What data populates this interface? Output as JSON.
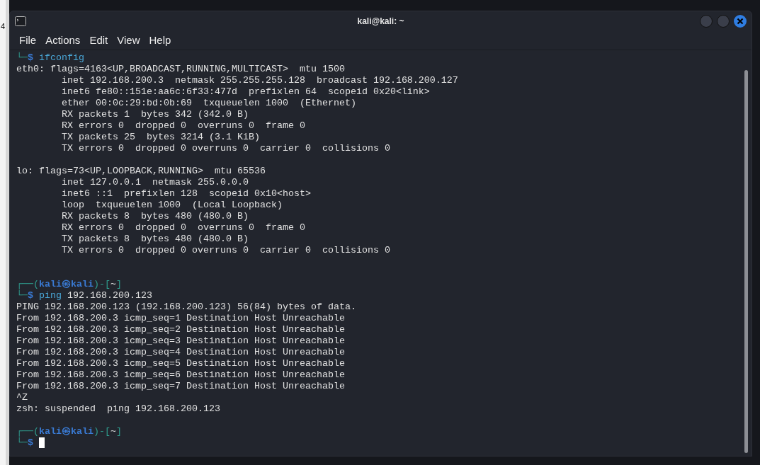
{
  "desktop": {
    "edge_text": "4"
  },
  "window": {
    "title": "kali@kali: ~",
    "controls": [
      {
        "kind": "minimize"
      },
      {
        "kind": "maximize"
      },
      {
        "kind": "close"
      }
    ]
  },
  "menu": [
    "File",
    "Actions",
    "Edit",
    "View",
    "Help"
  ],
  "lines": [
    {
      "kind": "text",
      "segments": [
        {
          "kind": "frame",
          "text": "└─"
        },
        {
          "kind": "dollar",
          "text": "$"
        },
        {
          "kind": "cmd",
          "text": "ifconfig"
        }
      ]
    },
    {
      "kind": "text",
      "segments": [
        {
          "kind": "plain",
          "text": "eth0: flags=4163<UP,BROADCAST,RUNNING,MULTICAST>  mtu 1500"
        }
      ]
    },
    {
      "kind": "text",
      "segments": [
        {
          "kind": "plain",
          "text": "        inet 192.168.200.3  netmask 255.255.255.128  broadcast 192.168.200.127"
        }
      ]
    },
    {
      "kind": "text",
      "segments": [
        {
          "kind": "plain",
          "text": "        inet6 fe80::151e:aa6c:6f33:477d  prefixlen 64  scopeid 0x20<link>"
        }
      ]
    },
    {
      "kind": "text",
      "segments": [
        {
          "kind": "plain",
          "text": "        ether 00:0c:29:bd:0b:69  txqueuelen 1000  (Ethernet)"
        }
      ]
    },
    {
      "kind": "text",
      "segments": [
        {
          "kind": "plain",
          "text": "        RX packets 1  bytes 342 (342.0 B)"
        }
      ]
    },
    {
      "kind": "text",
      "segments": [
        {
          "kind": "plain",
          "text": "        RX errors 0  dropped 0  overruns 0  frame 0"
        }
      ]
    },
    {
      "kind": "text",
      "segments": [
        {
          "kind": "plain",
          "text": "        TX packets 25  bytes 3214 (3.1 KiB)"
        }
      ]
    },
    {
      "kind": "text",
      "segments": [
        {
          "kind": "plain",
          "text": "        TX errors 0  dropped 0 overruns 0  carrier 0  collisions 0"
        }
      ]
    },
    {
      "kind": "blank"
    },
    {
      "kind": "text",
      "segments": [
        {
          "kind": "plain",
          "text": "lo: flags=73<UP,LOOPBACK,RUNNING>  mtu 65536"
        }
      ]
    },
    {
      "kind": "text",
      "segments": [
        {
          "kind": "plain",
          "text": "        inet 127.0.0.1  netmask 255.0.0.0"
        }
      ]
    },
    {
      "kind": "text",
      "segments": [
        {
          "kind": "plain",
          "text": "        inet6 ::1  prefixlen 128  scopeid 0x10<host>"
        }
      ]
    },
    {
      "kind": "text",
      "segments": [
        {
          "kind": "plain",
          "text": "        loop  txqueuelen 1000  (Local Loopback)"
        }
      ]
    },
    {
      "kind": "text",
      "segments": [
        {
          "kind": "plain",
          "text": "        RX packets 8  bytes 480 (480.0 B)"
        }
      ]
    },
    {
      "kind": "text",
      "segments": [
        {
          "kind": "plain",
          "text": "        RX errors 0  dropped 0  overruns 0  frame 0"
        }
      ]
    },
    {
      "kind": "text",
      "segments": [
        {
          "kind": "plain",
          "text": "        TX packets 8  bytes 480 (480.0 B)"
        }
      ]
    },
    {
      "kind": "text",
      "segments": [
        {
          "kind": "plain",
          "text": "        TX errors 0  dropped 0 overruns 0  carrier 0  collisions 0"
        }
      ]
    },
    {
      "kind": "blank"
    },
    {
      "kind": "blank"
    },
    {
      "kind": "text",
      "segments": [
        {
          "kind": "frame",
          "text": "┌──("
        },
        {
          "kind": "user",
          "text": "kali㉿kali"
        },
        {
          "kind": "frame",
          "text": ")-["
        },
        {
          "kind": "plain",
          "text": "~"
        },
        {
          "kind": "frame",
          "text": "]"
        }
      ]
    },
    {
      "kind": "text",
      "segments": [
        {
          "kind": "frame",
          "text": "└─"
        },
        {
          "kind": "dollar",
          "text": "$"
        },
        {
          "kind": "cmd",
          "text": "ping"
        },
        {
          "kind": "args",
          "text": "192.168.200.123"
        }
      ]
    },
    {
      "kind": "text",
      "segments": [
        {
          "kind": "plain",
          "text": "PING 192.168.200.123 (192.168.200.123) 56(84) bytes of data."
        }
      ]
    },
    {
      "kind": "text",
      "segments": [
        {
          "kind": "plain",
          "text": "From 192.168.200.3 icmp_seq=1 Destination Host Unreachable"
        }
      ]
    },
    {
      "kind": "text",
      "segments": [
        {
          "kind": "plain",
          "text": "From 192.168.200.3 icmp_seq=2 Destination Host Unreachable"
        }
      ]
    },
    {
      "kind": "text",
      "segments": [
        {
          "kind": "plain",
          "text": "From 192.168.200.3 icmp_seq=3 Destination Host Unreachable"
        }
      ]
    },
    {
      "kind": "text",
      "segments": [
        {
          "kind": "plain",
          "text": "From 192.168.200.3 icmp_seq=4 Destination Host Unreachable"
        }
      ]
    },
    {
      "kind": "text",
      "segments": [
        {
          "kind": "plain",
          "text": "From 192.168.200.3 icmp_seq=5 Destination Host Unreachable"
        }
      ]
    },
    {
      "kind": "text",
      "segments": [
        {
          "kind": "plain",
          "text": "From 192.168.200.3 icmp_seq=6 Destination Host Unreachable"
        }
      ]
    },
    {
      "kind": "text",
      "segments": [
        {
          "kind": "plain",
          "text": "From 192.168.200.3 icmp_seq=7 Destination Host Unreachable"
        }
      ]
    },
    {
      "kind": "text",
      "segments": [
        {
          "kind": "plain",
          "text": "^Z"
        }
      ]
    },
    {
      "kind": "text",
      "segments": [
        {
          "kind": "plain",
          "text": "zsh: suspended  ping 192.168.200.123"
        }
      ]
    },
    {
      "kind": "blank"
    },
    {
      "kind": "text",
      "segments": [
        {
          "kind": "frame",
          "text": "┌──("
        },
        {
          "kind": "user",
          "text": "kali㉿kali"
        },
        {
          "kind": "frame",
          "text": ")-["
        },
        {
          "kind": "plain",
          "text": "~"
        },
        {
          "kind": "frame",
          "text": "]"
        }
      ]
    },
    {
      "kind": "text",
      "segments": [
        {
          "kind": "frame",
          "text": "└─"
        },
        {
          "kind": "dollar",
          "text": "$"
        },
        {
          "kind": "cursor"
        }
      ]
    }
  ]
}
